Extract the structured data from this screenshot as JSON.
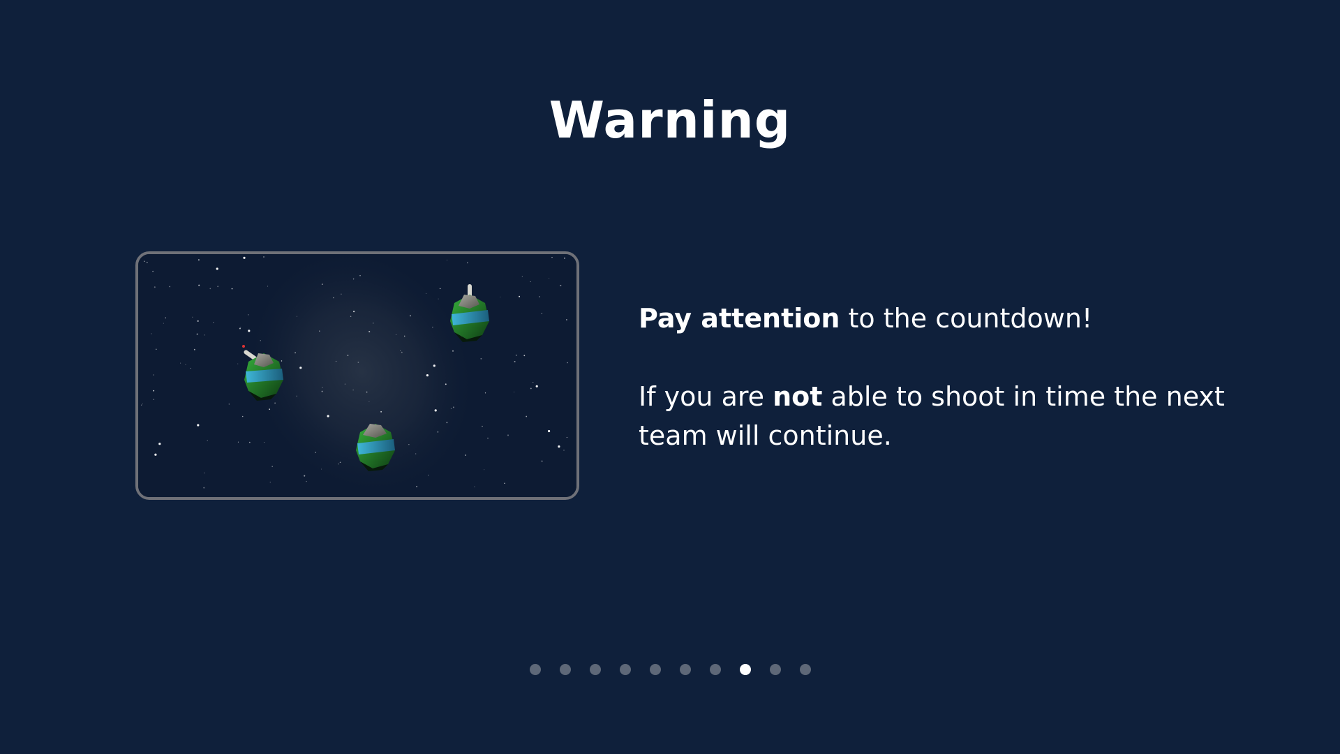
{
  "title": "Warning",
  "instructions": {
    "line1_bold": "Pay attention",
    "line1_rest": " to the countdown!",
    "line2_start": "If you are ",
    "line2_bold": "not",
    "line2_end": " able to shoot in time the next team will continue."
  },
  "pagination": {
    "total": 10,
    "active_index": 7
  },
  "colors": {
    "background": "#0f203b",
    "frame_border": "#6f7178",
    "dot_inactive": "#5e6878",
    "dot_active": "#ffffff",
    "planet_green": "#1f7a25",
    "planet_blue": "#2a8fb0"
  },
  "preview": {
    "icons": [
      "planet-with-cannon-icon",
      "planet-with-cannon-icon",
      "planet-icon"
    ]
  }
}
